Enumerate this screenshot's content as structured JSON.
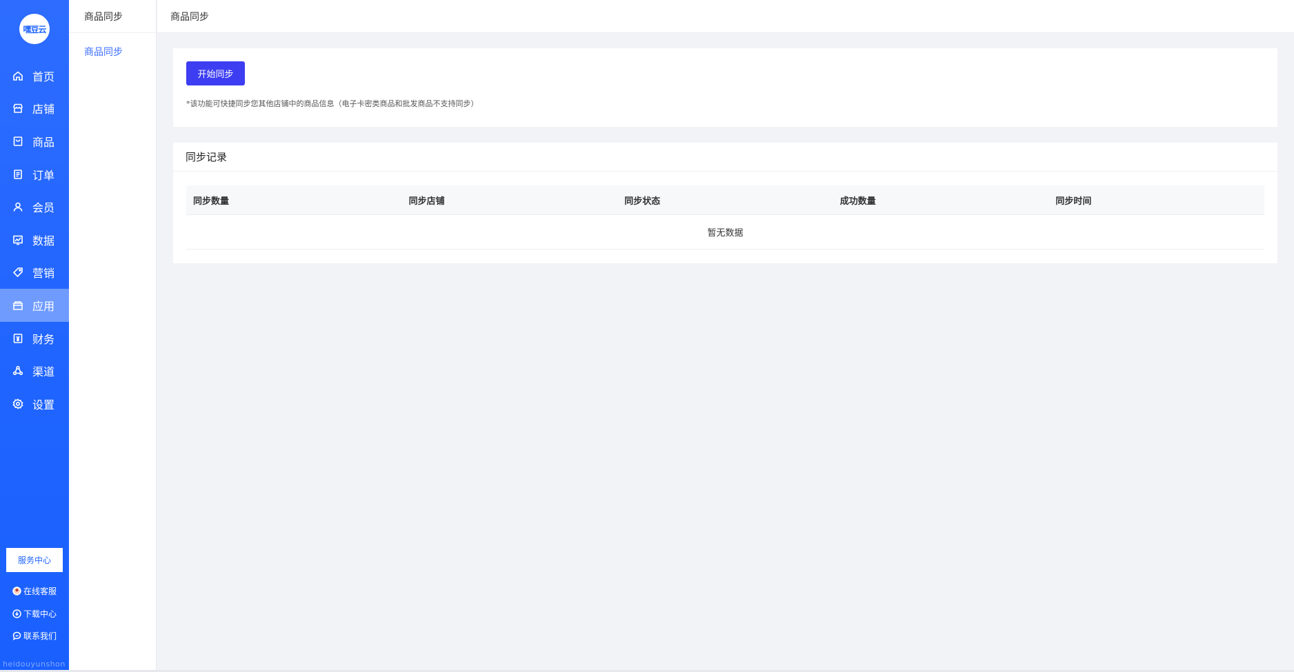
{
  "brand": {
    "logo_text": "嘿豆云",
    "watermark": "heidouyunshon"
  },
  "sidebar": {
    "items": [
      {
        "label": "首页",
        "icon": "home-icon",
        "active": false
      },
      {
        "label": "店铺",
        "icon": "store-icon",
        "active": false
      },
      {
        "label": "商品",
        "icon": "goods-icon",
        "active": false
      },
      {
        "label": "订单",
        "icon": "order-icon",
        "active": false
      },
      {
        "label": "会员",
        "icon": "member-icon",
        "active": false
      },
      {
        "label": "数据",
        "icon": "chart-icon",
        "active": false
      },
      {
        "label": "营销",
        "icon": "tag-icon",
        "active": false
      },
      {
        "label": "应用",
        "icon": "app-store-icon",
        "active": true
      },
      {
        "label": "财务",
        "icon": "finance-icon",
        "active": false
      },
      {
        "label": "渠道",
        "icon": "channel-icon",
        "active": false
      },
      {
        "label": "设置",
        "icon": "settings-icon",
        "active": false
      }
    ],
    "service_button": "服务中心",
    "links": [
      {
        "label": "在线客服",
        "icon": "avatar-icon"
      },
      {
        "label": "下载中心",
        "icon": "download-icon"
      },
      {
        "label": "联系我们",
        "icon": "chat-icon"
      }
    ]
  },
  "submenu": {
    "title": "商品同步",
    "items": [
      {
        "label": "商品同步",
        "active": true
      }
    ]
  },
  "header": {
    "breadcrumb": "商品同步"
  },
  "sync_card": {
    "button_label": "开始同步",
    "tip": "*该功能可快捷同步您其他店铺中的商品信息（电子卡密类商品和批发商品不支持同步）"
  },
  "records": {
    "title": "同步记录",
    "columns": [
      "同步数量",
      "同步店铺",
      "同步状态",
      "成功数量",
      "同步时间"
    ],
    "empty_text": "暂无数据"
  },
  "colors": {
    "sidebar": "#1f64ff",
    "accent": "#3d3df2",
    "link": "#3c6dff",
    "bg": "#f2f3f7"
  }
}
